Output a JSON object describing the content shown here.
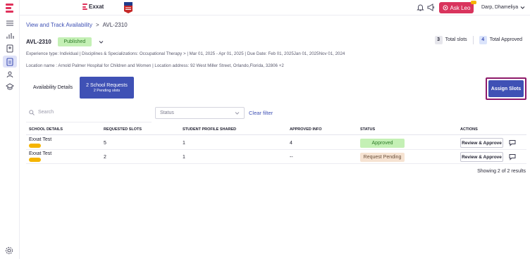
{
  "app": {
    "brand": "Exxat",
    "user_name": "Darp, Dhameliya",
    "ask_leo": "Ask Leo"
  },
  "nav_icons": [
    "menu-icon",
    "analytics-icon",
    "document-icon",
    "slots-icon",
    "handshake-icon",
    "graduation-icon",
    "settings-icon"
  ],
  "breadcrumb": {
    "parent": "View and Track Availability",
    "separator": ">",
    "current": "AVL-2310"
  },
  "header": {
    "slot_id": "AVL-2310",
    "status": "Published",
    "total_slots_count": "3",
    "total_slots_label": "Total slots",
    "total_approved_count": "4",
    "total_approved_label": "Total Approved"
  },
  "meta": {
    "line1": "Experience type: Individual  |  Disciplines & Specializations:  Occupational Therapy  >  |  Mar 01, 2025  -  Apr 01, 2025  |  Due Date: Feb 01, 2025Jan 01, 2025Nov 01, 2024",
    "line2": "Location name : Arnold Palmer Hospital for Children and Women  |  Location address: 92 West Miller Street, Orlando,Florida, 32806    +2"
  },
  "tabs": {
    "availability": "Availability Details",
    "requests_title": "2 School Requests",
    "requests_sub": "2 Pending slots"
  },
  "assign_button": "Assign Slots",
  "filters": {
    "search_placeholder": "Search",
    "status_placeholder": "Status",
    "clear": "Clear filter"
  },
  "table": {
    "columns": [
      "SCHOOL DETAILS",
      "REQUESTED SLOTS",
      "STUDENT PROFILE SHARED",
      "APPROVED INFO",
      "STATUS",
      "ACTIONS"
    ],
    "rows": [
      {
        "school": "Exxat Test",
        "requested": "5",
        "shared": "1",
        "approved": "4",
        "status": "Approved",
        "action": "Review & Approve"
      },
      {
        "school": "Exxat Test",
        "requested": "2",
        "shared": "1",
        "approved": "--",
        "status": "Request Pending",
        "action": "Review & Approve"
      }
    ],
    "footer": "Showing 2 of 2 results"
  },
  "colors": {
    "primary": "#3f51b5",
    "brand_red": "#e0315b",
    "approved_bg": "#c4f0b5",
    "pending_bg": "#f6e3d2",
    "highlight": "#8e1a6a"
  }
}
